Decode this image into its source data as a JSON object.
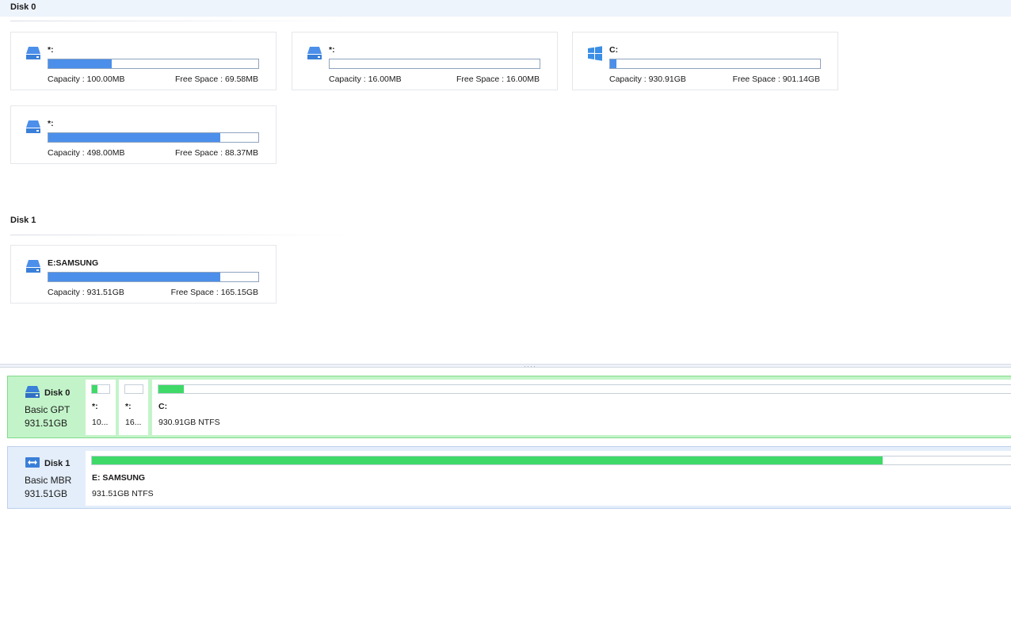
{
  "disks": [
    {
      "title": "Disk 0",
      "partitions": [
        {
          "name": "*:",
          "capacity_label": "Capacity : 100.00MB",
          "free_label": "Free Space : 69.58MB",
          "used_fraction": 0.3,
          "icon": "drive-icon"
        },
        {
          "name": "*:",
          "capacity_label": "Capacity : 16.00MB",
          "free_label": "Free Space : 16.00MB",
          "used_fraction": 0.0,
          "icon": "drive-icon"
        },
        {
          "name": "C:",
          "capacity_label": "Capacity : 930.91GB",
          "free_label": "Free Space : 901.14GB",
          "used_fraction": 0.03,
          "icon": "windows-icon"
        },
        {
          "name": "*:",
          "capacity_label": "Capacity : 498.00MB",
          "free_label": "Free Space : 88.37MB",
          "used_fraction": 0.82,
          "icon": "drive-icon"
        }
      ]
    },
    {
      "title": "Disk 1",
      "partitions": [
        {
          "name": "E:SAMSUNG",
          "capacity_label": "Capacity : 931.51GB",
          "free_label": "Free Space : 165.15GB",
          "used_fraction": 0.82,
          "icon": "drive-icon"
        }
      ]
    }
  ],
  "disk_map": [
    {
      "name": "Disk 0",
      "type": "Basic GPT",
      "size": "931.51GB",
      "icon": "drive-icon",
      "partitions": [
        {
          "name": "*:",
          "info": "10...",
          "used_fraction": 0.3
        },
        {
          "name": "*:",
          "info": "16...",
          "used_fraction": 0.0
        },
        {
          "name": "C:",
          "info": "930.91GB NTFS",
          "used_fraction": 0.03
        }
      ]
    },
    {
      "name": "Disk 1",
      "type": "Basic MBR",
      "size": "931.51GB",
      "icon": "drive-transfer-icon",
      "partitions": [
        {
          "name": "E: SAMSUNG",
          "info": "931.51GB NTFS",
          "used_fraction": 0.86
        }
      ]
    }
  ],
  "colors": {
    "card_bar": "#4b8fea",
    "map_bar": "#3fd968",
    "selected_row": "#c3f4c9",
    "row_bg": "#e4eefb"
  }
}
